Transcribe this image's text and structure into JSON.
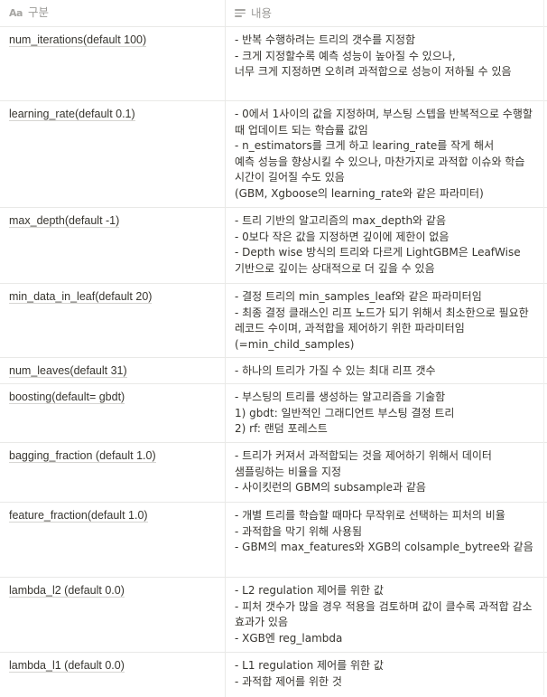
{
  "header": {
    "name_label": "구분",
    "desc_label": "내용"
  },
  "rows": [
    {
      "name": "num_iterations(default 100)",
      "desc": "- 반복 수행하려는 트리의 갯수를 지정함\n- 크게 지정할수록 예측 성능이 높아질 수 있으나,\n너무 크게 지정하면 오히려 과적합으로 성능이 저하될 수 있음"
    },
    {
      "name": "learning_rate(default 0.1)",
      "desc": "- 0에서 1사이의 값을 지정하며, 부스팅 스텝을 반복적으로 수행할 때 업데이트 되는 학습률 값임\n- n_estimators를 크게 하고 learing_rate를 작게 해서\n예측 성능을 향상시킬 수 있으나, 마찬가지로 과적합 이슈와 학습 시간이 길어질 수도 있음\n(GBM, Xgboose의 learning_rate와 같은 파라미터)"
    },
    {
      "name": "max_depth(default -1)",
      "desc": "- 트리 기반의 알고리즘의 max_depth와 같음\n- 0보다 작은 값을 지정하면 깊이에 제한이 없음\n- Depth wise 방식의 트리와 다르게 LightGBM은 LeafWise 기반으로 깊이는 상대적으로 더 깊을 수 있음"
    },
    {
      "name": "min_data_in_leaf(default 20)",
      "desc": "- 결정 트리의 min_samples_leaf와 같은 파라미터임\n- 최종 결정 클래스인 리프 노드가 되기 위해서 최소한으로 필요한 레코드 수이며, 과적합을 제어하기 위한 파라미터임\n(=min_child_samples)"
    },
    {
      "name": "num_leaves(default 31)",
      "desc": "- 하나의 트리가 가질 수 있는 최대 리프 갯수"
    },
    {
      "name": "boosting(default= gbdt)",
      "desc": "- 부스팅의 트리를 생성하는 알고리즘을 기술함\n1) gbdt: 일반적인 그래디언트 부스팅 결정 트리\n2) rf: 랜덤 포레스트"
    },
    {
      "name": "bagging_fraction (default 1.0)",
      "desc": "- 트리가 커져서 과적합되는 것을 제어하기 위해서 데이터 샘플링하는 비율을 지정\n- 사이킷런의 GBM의 subsample과 같음"
    },
    {
      "name": "feature_fraction(default 1.0)",
      "desc": "- 개별 트리를 학습할 때마다 무작위로 선택하는 피처의 비율\n- 과적합을 막기 위해 사용됨\n- GBM의 max_features와 XGB의 colsample_bytree와 같음"
    },
    {
      "name": "lambda_l2 (default 0.0)",
      "desc": "- L2 regulation 제어를 위한 값\n- 피처 갯수가 많을 경우 적용을 검토하며 값이 클수록 과적합 감소 효과가 있음\n- XGB엔 reg_lambda"
    },
    {
      "name": "lambda_l1 (default 0.0)",
      "desc": "- L1 regulation 제어를 위한 값\n- 과적합 제어를 위한 것"
    }
  ]
}
